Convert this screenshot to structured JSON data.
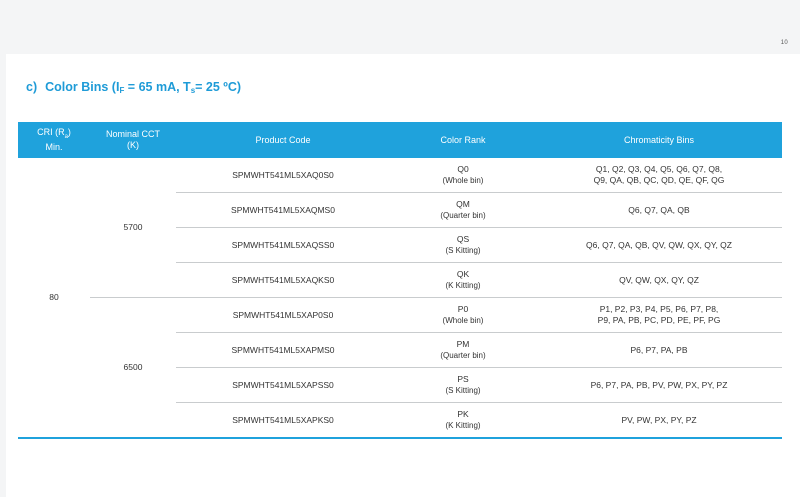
{
  "page_number": "10",
  "section": {
    "label": "c)",
    "title_main": "Color Bins (I",
    "title_sub1": "F",
    "title_mid": " = 65 mA, T",
    "title_sub2": "s",
    "title_end": "= 25 ºC)"
  },
  "table": {
    "headers": {
      "cri_line1": "CRI (R",
      "cri_sub": "a",
      "cri_close": ")",
      "cri_line2": "Min.",
      "cct_line1": "Nominal CCT",
      "cct_line2": "(K)",
      "product_code": "Product Code",
      "color_rank": "Color Rank",
      "chromaticity": "Chromaticity Bins"
    },
    "cri_value": "80",
    "cct_groups": [
      "5700",
      "6500"
    ],
    "rows": [
      {
        "code": "SPMWHT541ML5XAQ0S0",
        "rank": "Q0",
        "rank_sub": "(Whole bin)",
        "bins_line1": "Q1, Q2, Q3, Q4, Q5, Q6, Q7, Q8,",
        "bins_line2": "Q9, QA, QB, QC, QD, QE, QF, QG"
      },
      {
        "code": "SPMWHT541ML5XAQMS0",
        "rank": "QM",
        "rank_sub": "(Quarter bin)",
        "bins_line1": "Q6, Q7, QA, QB",
        "bins_line2": ""
      },
      {
        "code": "SPMWHT541ML5XAQSS0",
        "rank": "QS",
        "rank_sub": "(S Kitting)",
        "bins_line1": "Q6, Q7, QA, QB, QV, QW, QX, QY, QZ",
        "bins_line2": ""
      },
      {
        "code": "SPMWHT541ML5XAQKS0",
        "rank": "QK",
        "rank_sub": "(K Kitting)",
        "bins_line1": "QV, QW, QX, QY, QZ",
        "bins_line2": ""
      },
      {
        "code": "SPMWHT541ML5XAP0S0",
        "rank": "P0",
        "rank_sub": "(Whole bin)",
        "bins_line1": "P1, P2, P3, P4, P5, P6, P7, P8,",
        "bins_line2": "P9, PA, PB, PC, PD, PE, PF, PG"
      },
      {
        "code": "SPMWHT541ML5XAPMS0",
        "rank": "PM",
        "rank_sub": "(Quarter bin)",
        "bins_line1": "P6, P7, PA, PB",
        "bins_line2": ""
      },
      {
        "code": "SPMWHT541ML5XAPSS0",
        "rank": "PS",
        "rank_sub": "(S Kitting)",
        "bins_line1": "P6, P7, PA, PB, PV, PW, PX, PY, PZ",
        "bins_line2": ""
      },
      {
        "code": "SPMWHT541ML5XAPKS0",
        "rank": "PK",
        "rank_sub": "(K Kitting)",
        "bins_line1": "PV, PW, PX, PY, PZ",
        "bins_line2": ""
      }
    ]
  },
  "colors": {
    "accent": "#1fa2dc",
    "title": "#1e9bd7",
    "divider": "#c9ccce"
  }
}
